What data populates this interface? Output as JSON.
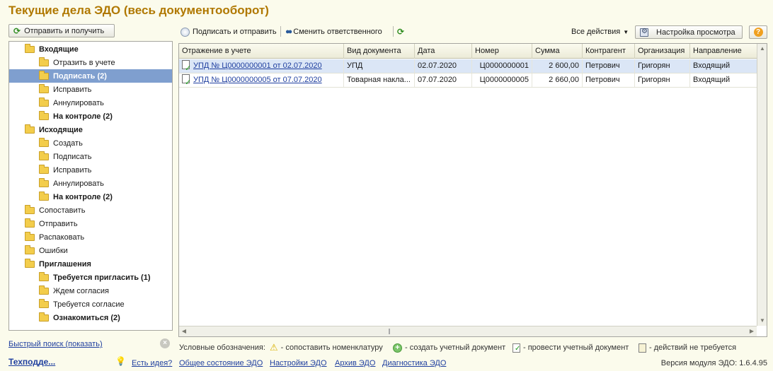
{
  "window": {
    "title": "Текущие дела ЭДО (весь документооборот)"
  },
  "left": {
    "send_receive_label": "Отправить и получить",
    "tree": [
      {
        "label": "Входящие",
        "bold": true,
        "level": 0
      },
      {
        "label": "Отразить в учете",
        "bold": false,
        "level": 1
      },
      {
        "label": "Подписать (2)",
        "bold": true,
        "level": 1,
        "selected": true
      },
      {
        "label": "Исправить",
        "bold": false,
        "level": 1
      },
      {
        "label": "Аннулировать",
        "bold": false,
        "level": 1
      },
      {
        "label": "На контроле (2)",
        "bold": true,
        "level": 1
      },
      {
        "label": "Исходящие",
        "bold": true,
        "level": 0
      },
      {
        "label": "Создать",
        "bold": false,
        "level": 1
      },
      {
        "label": "Подписать",
        "bold": false,
        "level": 1
      },
      {
        "label": "Исправить",
        "bold": false,
        "level": 1
      },
      {
        "label": "Аннулировать",
        "bold": false,
        "level": 1
      },
      {
        "label": "На контроле (2)",
        "bold": true,
        "level": 1
      },
      {
        "label": "Сопоставить",
        "bold": false,
        "level": 0
      },
      {
        "label": "Отправить",
        "bold": false,
        "level": 0
      },
      {
        "label": "Распаковать",
        "bold": false,
        "level": 0
      },
      {
        "label": "Ошибки",
        "bold": false,
        "level": 0
      },
      {
        "label": "Приглашения",
        "bold": true,
        "level": 0
      },
      {
        "label": "Требуется пригласить (1)",
        "bold": true,
        "level": 1
      },
      {
        "label": "Ждем согласия",
        "bold": false,
        "level": 1
      },
      {
        "label": "Требуется согласие",
        "bold": false,
        "level": 1
      },
      {
        "label": "Ознакомиться (2)",
        "bold": true,
        "level": 1
      }
    ],
    "quick_search_label": "Быстрый поиск (показать)"
  },
  "toolbar": {
    "sign_send_label": "Подписать и отправить",
    "change_responsible_label": "Сменить ответственного",
    "all_actions_label": "Все действия",
    "view_settings_label": "Настройка просмотра"
  },
  "grid": {
    "columns": [
      "Отражение в учете",
      "Вид документа",
      "Дата",
      "Номер",
      "Сумма",
      "Контрагент",
      "Организация",
      "Направление"
    ],
    "rows": [
      [
        "УПД № Ц0000000001 от 02.07.2020",
        "УПД",
        "02.07.2020",
        "Ц0000000001",
        "2 600,00",
        "Петрович",
        "Григорян",
        "Входящий"
      ],
      [
        "УПД № Ц0000000005 от 07.07.2020",
        "Товарная накла...",
        "07.07.2020",
        "Ц0000000005",
        "2 660,00",
        "Петрович",
        "Григорян",
        "Входящий"
      ]
    ]
  },
  "legend": {
    "title": "Условные обозначения:",
    "items": [
      {
        "icon": "warning-icon",
        "label": "- сопоставить номенклатуру"
      },
      {
        "icon": "plus-icon",
        "label": "- создать учетный документ"
      },
      {
        "icon": "post-doc-icon",
        "label": "- провести учетный документ"
      },
      {
        "icon": "no-action-icon",
        "label": "- действий не требуется"
      }
    ]
  },
  "footer": {
    "tech_label": "Техподде...",
    "idea_label": "Есть идея?",
    "links": [
      "Общее состояние ЭДО",
      "Настройки ЭДО",
      "Архив ЭДО",
      "Диагностика ЭДО"
    ],
    "version": "Версия модуля ЭДО: 1.6.4.95"
  }
}
